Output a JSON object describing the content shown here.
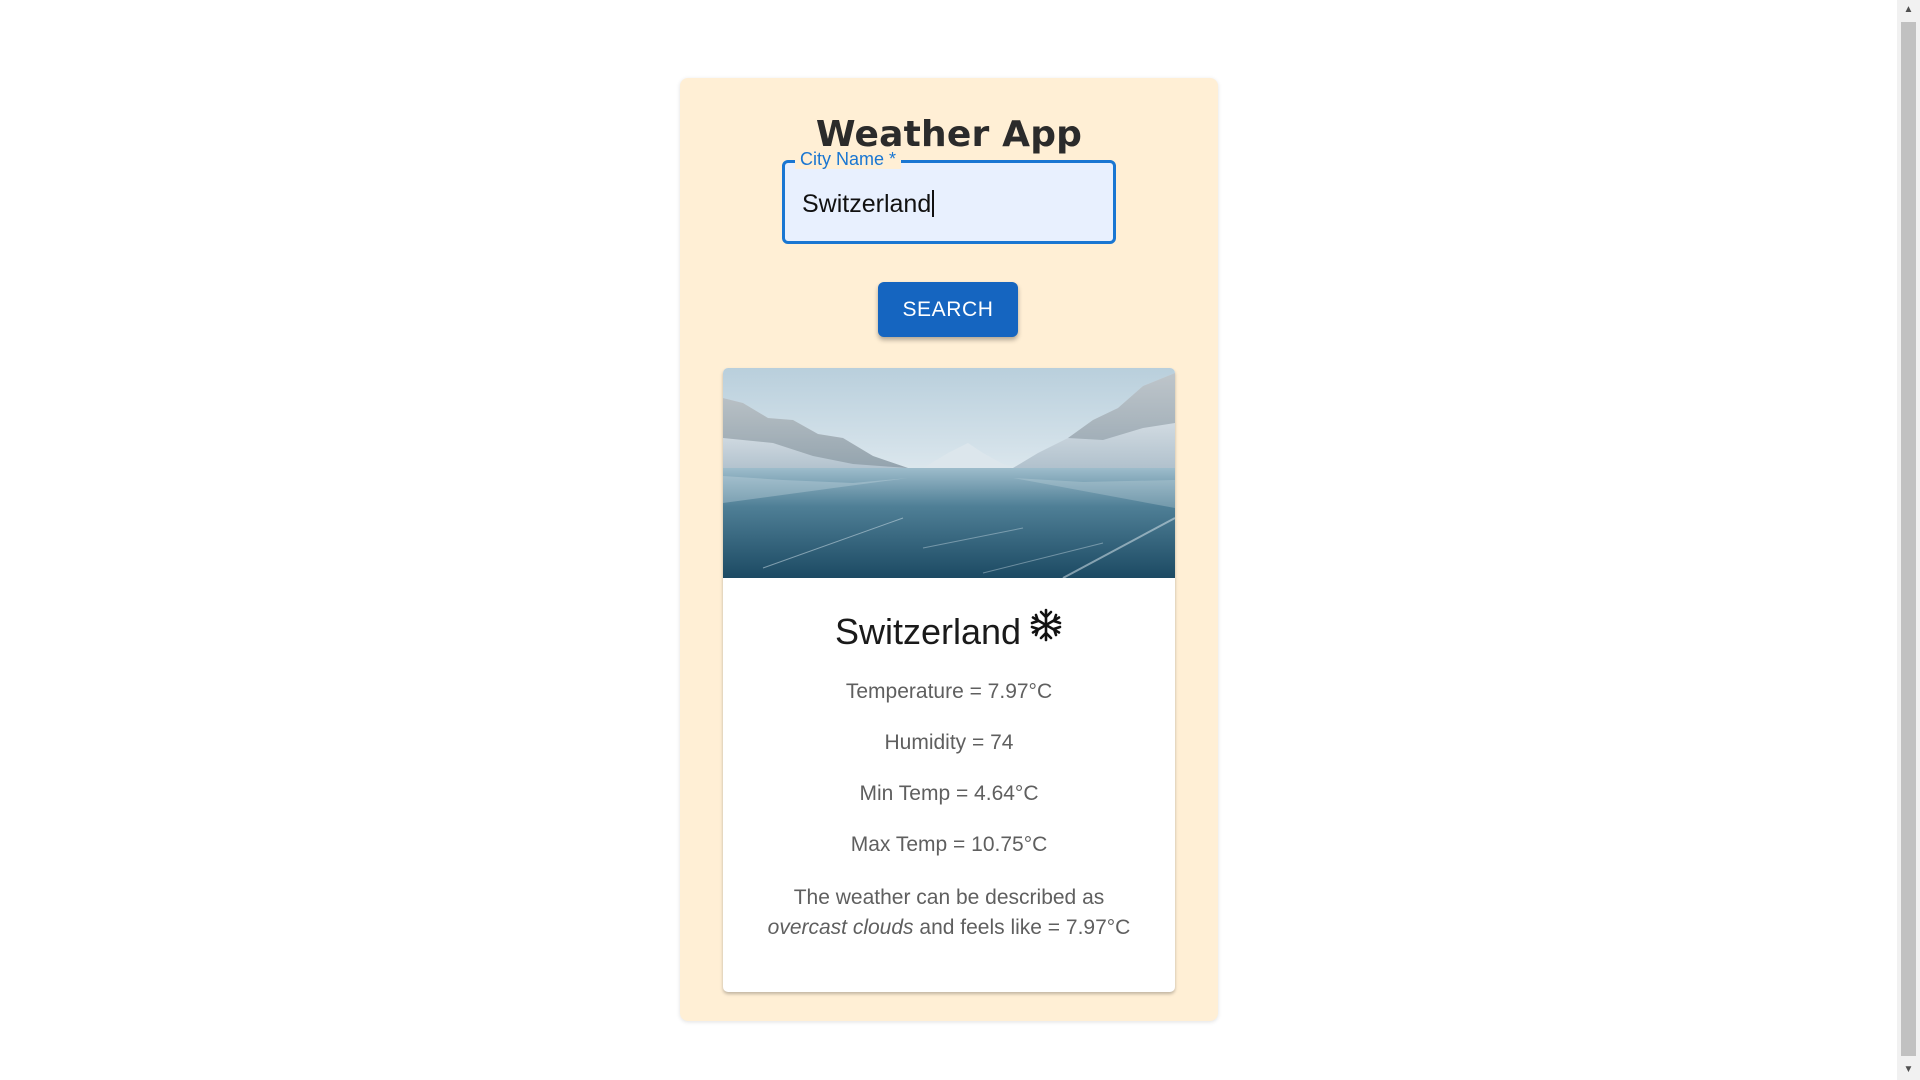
{
  "app": {
    "title": "Weather App"
  },
  "search": {
    "label": "City Name *",
    "value": "Switzerland",
    "button_label": "SEARCH"
  },
  "result": {
    "city": "Switzerland",
    "icon": "snowflake-icon",
    "temperature": "Temperature = 7.97°C",
    "humidity": "Humidity = 74",
    "min_temp": "Min Temp = 4.64°C",
    "max_temp": "Max Temp = 10.75°C",
    "description_prefix": "The weather can be described as",
    "description_condition": "overcast clouds",
    "description_suffix": "and feels like = 7.97°C"
  },
  "colors": {
    "panel_bg": "#ffefd5",
    "accent": "#1976d2",
    "button_bg": "#1565c0"
  }
}
